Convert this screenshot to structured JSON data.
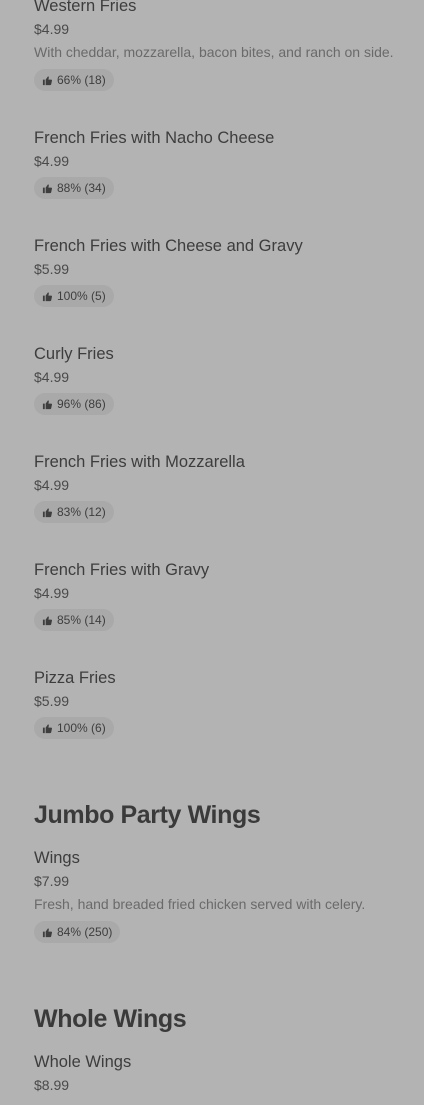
{
  "items_fries": [
    {
      "name": "Western Fries",
      "price": "$4.99",
      "desc": "With cheddar, mozzarella, bacon bites, and ranch on side.",
      "rating": "66% (18)"
    },
    {
      "name": "French Fries with Nacho Cheese",
      "price": "$4.99",
      "rating": "88% (34)"
    },
    {
      "name": "French Fries with Cheese and Gravy",
      "price": "$5.99",
      "rating": "100% (5)"
    },
    {
      "name": "Curly Fries",
      "price": "$4.99",
      "rating": "96% (86)"
    },
    {
      "name": "French Fries with Mozzarella",
      "price": "$4.99",
      "rating": "83% (12)"
    },
    {
      "name": "French Fries with Gravy",
      "price": "$4.99",
      "rating": "85% (14)"
    },
    {
      "name": "Pizza Fries",
      "price": "$5.99",
      "rating": "100% (6)"
    }
  ],
  "section_jumbo": {
    "title": "Jumbo Party Wings",
    "items": [
      {
        "name": "Wings",
        "price": "$7.99",
        "desc": "Fresh, hand breaded fried chicken served with celery.",
        "rating": "84% (250)"
      }
    ]
  },
  "section_whole": {
    "title": "Whole Wings",
    "items": [
      {
        "name": "Whole Wings",
        "price": "$8.99"
      }
    ]
  },
  "icons": {
    "rating": "thumbs-up-icon"
  }
}
